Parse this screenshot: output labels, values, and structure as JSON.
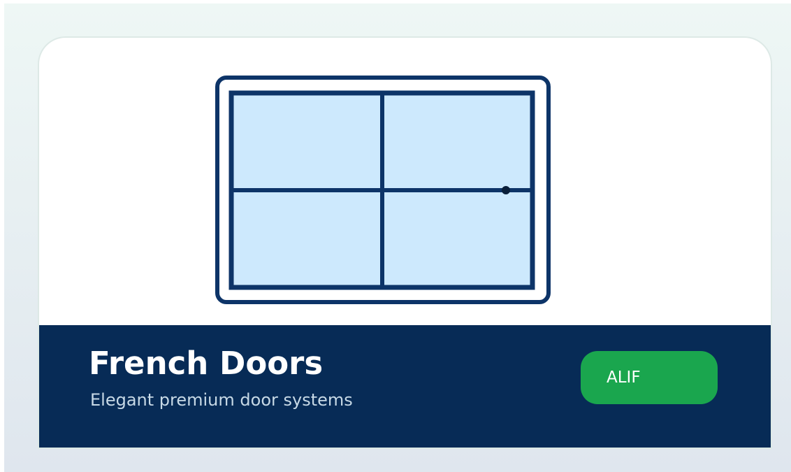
{
  "product": {
    "title": "French Doors",
    "subtitle": "Elegant premium door systems",
    "badge_label": "ALIF",
    "illustration_icon": "french-door-icon"
  },
  "colors": {
    "navy": "#072b56",
    "glass": "#cde9fd",
    "badge_green": "#1aa64e",
    "subtitle_text": "#c7d9e6"
  }
}
